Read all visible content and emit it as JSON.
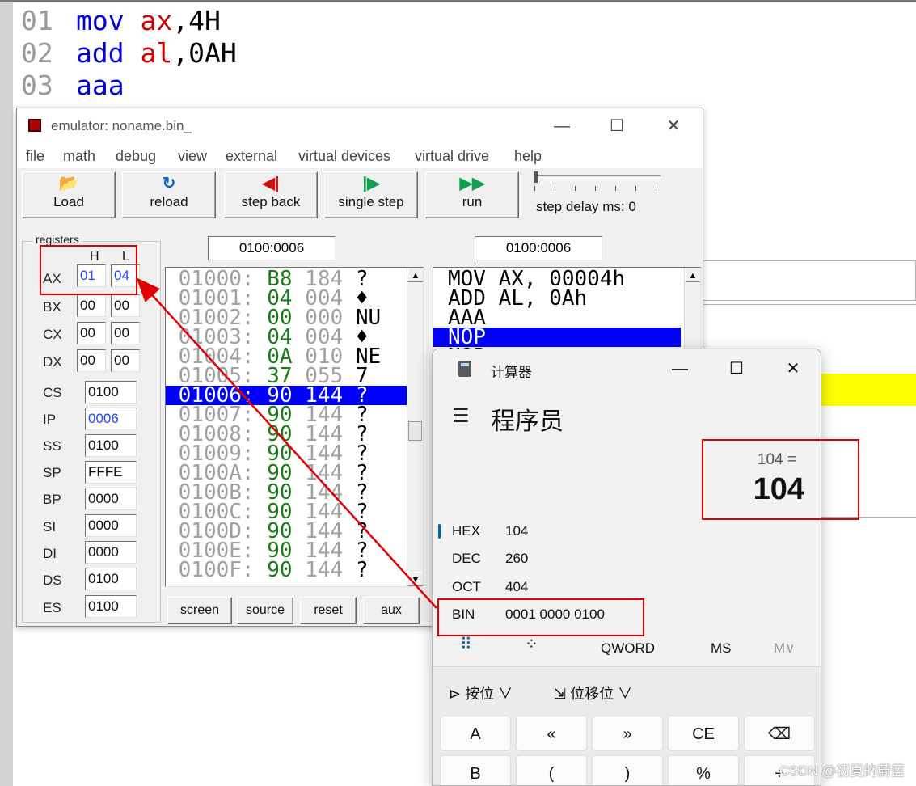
{
  "editor": {
    "lines": [
      {
        "num": "01",
        "op": "mov",
        "reg": "ax",
        "sep": ",",
        "arg": "4H"
      },
      {
        "num": "02",
        "op": "add",
        "reg": "al",
        "sep": ",",
        "arg": "0AH"
      },
      {
        "num": "03",
        "op": "aaa",
        "reg": "",
        "sep": "",
        "arg": ""
      }
    ]
  },
  "emulator": {
    "title": "emulator: noname.bin_",
    "window_controls": {
      "minimize": "—",
      "maximize": "☐",
      "close": "✕"
    },
    "menu": [
      "file",
      "math",
      "debug",
      "view",
      "external",
      "virtual devices",
      "virtual drive",
      "help"
    ],
    "toolbar": [
      {
        "label": "Load",
        "icon": "folder-open-icon",
        "glyph": "📂"
      },
      {
        "label": "reload",
        "icon": "reload-icon",
        "glyph": "↻"
      },
      {
        "label": "step back",
        "icon": "step-back-icon",
        "glyph": "◀|"
      },
      {
        "label": "single step",
        "icon": "single-step-icon",
        "glyph": "|▶"
      },
      {
        "label": "run",
        "icon": "run-icon",
        "glyph": "▶▶"
      }
    ],
    "step_delay_label": "step delay ms: 0",
    "step_delay_ms": 0,
    "registers_label": "registers",
    "h_label": "H",
    "l_label": "L",
    "registers_split": [
      {
        "name": "AX",
        "h": "01",
        "l": "04"
      },
      {
        "name": "BX",
        "h": "00",
        "l": "00"
      },
      {
        "name": "CX",
        "h": "00",
        "l": "00"
      },
      {
        "name": "DX",
        "h": "00",
        "l": "00"
      }
    ],
    "registers_full": [
      {
        "name": "CS",
        "value": "0100"
      },
      {
        "name": "IP",
        "value": "0006"
      },
      {
        "name": "SS",
        "value": "0100"
      },
      {
        "name": "SP",
        "value": "FFFE"
      },
      {
        "name": "BP",
        "value": "0000"
      },
      {
        "name": "SI",
        "value": "0000"
      },
      {
        "name": "DI",
        "value": "0000"
      },
      {
        "name": "DS",
        "value": "0100"
      },
      {
        "name": "ES",
        "value": "0100"
      }
    ],
    "memory_address": "0100:0006",
    "disasm_address": "0100:0006",
    "memory": [
      {
        "addr": "01000:",
        "hex": "B8",
        "dec": "184",
        "ch": "?"
      },
      {
        "addr": "01001:",
        "hex": "04",
        "dec": "004",
        "ch": "♦"
      },
      {
        "addr": "01002:",
        "hex": "00",
        "dec": "000",
        "ch": "NU"
      },
      {
        "addr": "01003:",
        "hex": "04",
        "dec": "004",
        "ch": "♦"
      },
      {
        "addr": "01004:",
        "hex": "0A",
        "dec": "010",
        "ch": "NE"
      },
      {
        "addr": "01005:",
        "hex": "37",
        "dec": "055",
        "ch": "7"
      },
      {
        "addr": "01006:",
        "hex": "90",
        "dec": "144",
        "ch": "?"
      },
      {
        "addr": "01007:",
        "hex": "90",
        "dec": "144",
        "ch": "?"
      },
      {
        "addr": "01008:",
        "hex": "90",
        "dec": "144",
        "ch": "?"
      },
      {
        "addr": "01009:",
        "hex": "90",
        "dec": "144",
        "ch": "?"
      },
      {
        "addr": "0100A:",
        "hex": "90",
        "dec": "144",
        "ch": "?"
      },
      {
        "addr": "0100B:",
        "hex": "90",
        "dec": "144",
        "ch": "?"
      },
      {
        "addr": "0100C:",
        "hex": "90",
        "dec": "144",
        "ch": "?"
      },
      {
        "addr": "0100D:",
        "hex": "90",
        "dec": "144",
        "ch": "?"
      },
      {
        "addr": "0100E:",
        "hex": "90",
        "dec": "144",
        "ch": "?"
      },
      {
        "addr": "0100F:",
        "hex": "90",
        "dec": "144",
        "ch": "?"
      }
    ],
    "memory_selected_index": 6,
    "disasm": [
      "MOV AX, 00004h",
      "ADD AL, 0Ah",
      "AAA",
      "NOP",
      "NOP"
    ],
    "disasm_selected_index": 3,
    "bottom_buttons": [
      "screen",
      "source",
      "reset",
      "aux"
    ]
  },
  "calculator": {
    "title": "计算器",
    "window_controls": {
      "minimize": "—",
      "maximize": "☐",
      "close": "✕"
    },
    "mode": "程序员",
    "expression": "104 =",
    "result": "104",
    "bases": [
      {
        "name": "HEX",
        "value": "104"
      },
      {
        "name": "DEC",
        "value": "260"
      },
      {
        "name": "OCT",
        "value": "404"
      },
      {
        "name": "BIN",
        "value": "0001 0000 0100"
      }
    ],
    "active_base": "HEX",
    "memory_bar": {
      "word_size": "QWORD",
      "ms": "MS",
      "mr": "M∨"
    },
    "bitwise_label": "按位",
    "bitshift_label": "位移位",
    "keys_row1": [
      "A",
      "«",
      "»",
      "CE",
      "⌫"
    ],
    "keys_row2": [
      "B",
      "(",
      ")",
      "%",
      "÷"
    ]
  },
  "watermark": "CSDN @初夏的蔚蓝",
  "colors": {
    "annotation": "#e00000",
    "selection": "#0000ff",
    "hex_green": "#1a7a1a",
    "highlight_yellow": "#ffff00"
  }
}
